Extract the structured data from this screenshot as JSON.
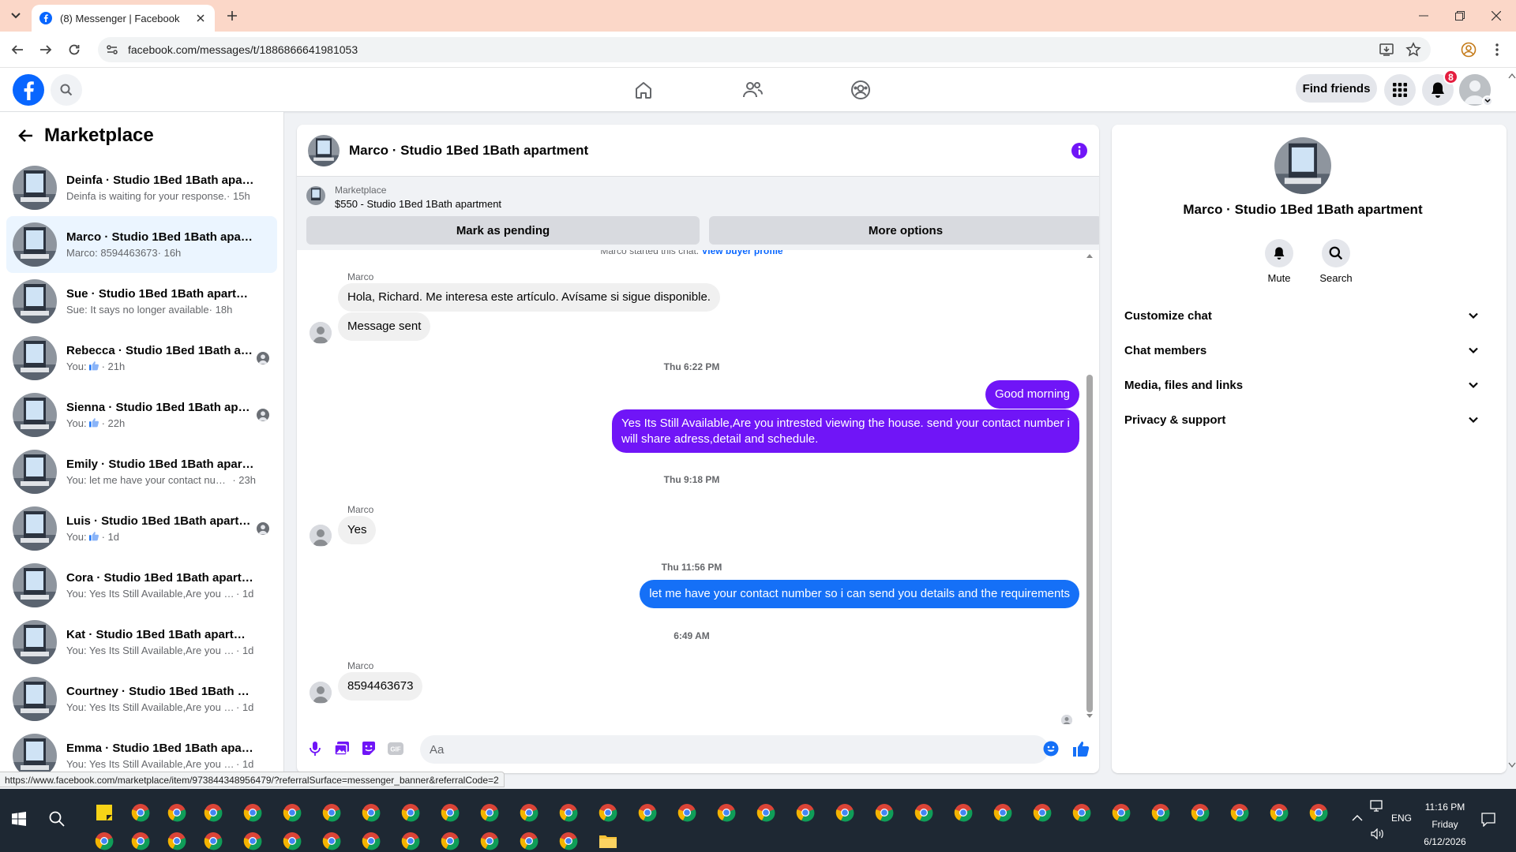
{
  "browser": {
    "tab_title": "(8) Messenger | Facebook",
    "url": "facebook.com/messages/t/1886866641981053",
    "status_url": "https://www.facebook.com/marketplace/item/973844348956479/?referralSurface=messenger_banner&referralCode=2"
  },
  "fb": {
    "find_friends": "Find friends",
    "notification_count": "8"
  },
  "sidebar": {
    "title": "Marketplace",
    "conversations": [
      {
        "name": "Deinfa · Studio 1Bed 1Bath apartm...",
        "preview": "Deinfa is waiting for your response.",
        "time": " · 15h",
        "active": false
      },
      {
        "name": "Marco · Studio 1Bed 1Bath apartm...",
        "preview": "Marco: 8594463673",
        "time": " · 16h",
        "active": true
      },
      {
        "name": "Sue · Studio 1Bed 1Bath apartment",
        "preview": "Sue: It says no longer available",
        "time": " · 18h",
        "active": false
      },
      {
        "name": "Rebecca · Studio 1Bed 1Bath apa...",
        "preview": "You:",
        "time": " · 21h",
        "active": false,
        "like": true
      },
      {
        "name": "Sienna · Studio 1Bed 1Bath apart...",
        "preview": "You:",
        "time": " · 22h",
        "active": false,
        "like": true
      },
      {
        "name": "Emily · Studio 1Bed 1Bath apartment",
        "preview": "You: let me have your contact numb...",
        "time": " · 23h",
        "active": false
      },
      {
        "name": "Luis · Studio 1Bed 1Bath apartm...",
        "preview": "You:",
        "time": " · 1d",
        "active": false,
        "like": true
      },
      {
        "name": "Cora · Studio 1Bed 1Bath apartment",
        "preview": "You: Yes Its Still Available,Are you intre...",
        "time": " · 1d",
        "active": false
      },
      {
        "name": "Kat · Studio 1Bed 1Bath apartment",
        "preview": "You: Yes Its Still Available,Are you intre...",
        "time": " · 1d",
        "active": false
      },
      {
        "name": "Courtney · Studio 1Bed 1Bath apar...",
        "preview": "You: Yes Its Still Available,Are you intre...",
        "time": " · 1d",
        "active": false
      },
      {
        "name": "Emma · Studio 1Bed 1Bath apartm...",
        "preview": "You: Yes Its Still Available,Are you intre...",
        "time": " · 1d",
        "active": false
      }
    ]
  },
  "chat": {
    "title": "Marco · Studio 1Bed 1Bath apartment",
    "banner_label": "Marketplace",
    "banner_item": "$550 - Studio 1Bed 1Bath apartment",
    "mark_pending": "Mark as pending",
    "more_options": "More options",
    "started_text": "Marco started this chat.",
    "view_buyer": "View buyer profile",
    "messages": {
      "sender1": "Marco",
      "in1": "Hola, Richard. Me interesa este artículo. Avísame si sigue disponible.",
      "in2": "Message sent",
      "ts1": "Thu 6:22 PM",
      "out1": "Good morning",
      "out2": "Yes Its Still Available,Are you intrested viewing the house. send your contact number i will share adress,detail and schedule.",
      "ts2": "Thu 9:18 PM",
      "sender2": "Marco",
      "in3": "Yes",
      "ts3": "Thu 11:56 PM",
      "out3": "let me have your contact number so i can send you details and the requirements",
      "ts4": "6:49 AM",
      "sender3": "Marco",
      "in4": "8594463673"
    },
    "composer_placeholder": "Aa"
  },
  "info": {
    "name": "Marco · Studio 1Bed 1Bath apartment",
    "mute": "Mute",
    "search": "Search",
    "rows": [
      "Customize chat",
      "Chat members",
      "Media, files and links",
      "Privacy & support"
    ]
  },
  "taskbar": {
    "time": "11:16 PM",
    "day": "Friday",
    "date": "6/12/2026",
    "lang": "ENG"
  },
  "colors": {
    "accent_purple": "#7015f7",
    "accent_blue": "#1570f7",
    "fb_blue": "#0866ff"
  }
}
